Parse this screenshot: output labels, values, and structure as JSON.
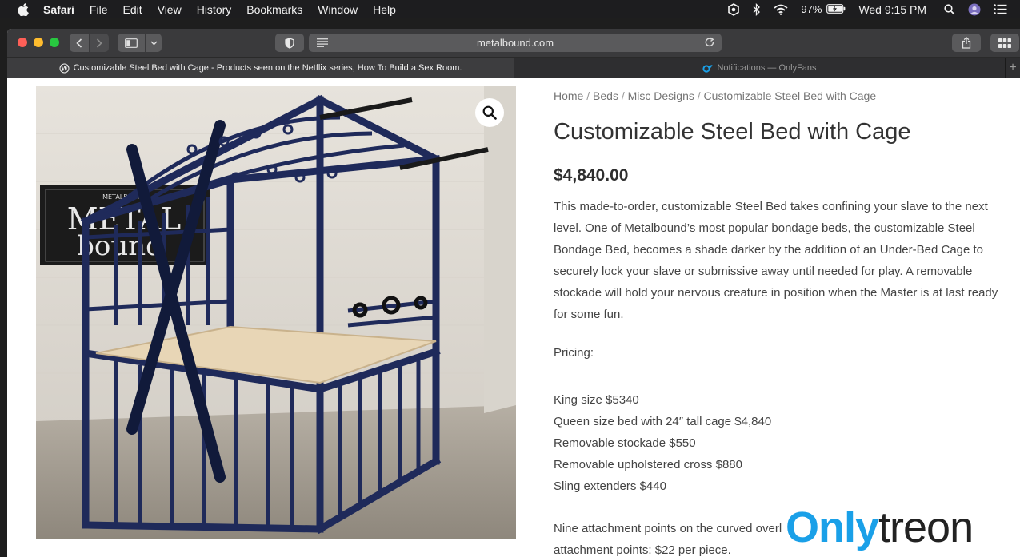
{
  "menubar": {
    "app_name": "Safari",
    "items": [
      "File",
      "Edit",
      "View",
      "History",
      "Bookmarks",
      "Window",
      "Help"
    ],
    "battery_percent": "97%",
    "clock": "Wed 9:15 PM"
  },
  "browser": {
    "url": "metalbound.com",
    "tabs": [
      {
        "title": "Customizable Steel Bed with Cage - Products seen on the Netflix series, How To Build a Sex Room.",
        "active": true
      },
      {
        "title": "Notifications — OnlyFans",
        "active": false
      }
    ],
    "new_tab_label": "+"
  },
  "product": {
    "breadcrumb": [
      "Home",
      "Beds",
      "Misc Designs",
      "Customizable Steel Bed with Cage"
    ],
    "breadcrumb_separator": "/",
    "title": "Customizable Steel Bed with Cage",
    "price": "$4,840.00",
    "description": "This made-to-order, customizable Steel Bed takes confining your slave to the next level. One of Metalbound’s most popular bondage beds, the customizable Steel Bondage Bed, becomes a shade darker by the addition of an Under-Bed Cage to securely lock your slave or submissive away until needed for play. A removable stockade will hold your nervous creature in position when the Master is at last ready for some fun.",
    "pricing_label": "Pricing:",
    "price_list": [
      "King size $5340",
      "Queen size bed with 24″ tall cage $4,840",
      "Removable stockade $550",
      "Removable upholstered cross $880",
      "Sling extenders $440"
    ],
    "attachment_text": "Nine attachment points on the curved overl",
    "attachment_text_2": "attachment points: $22 per piece.",
    "image_logo_text": [
      "METALBOUND",
      "METAL",
      "bound"
    ]
  },
  "watermark": {
    "part1": "Only",
    "part2": "treon"
  },
  "colors": {
    "accent": "#1aa0e8",
    "frame": "#1f2a5a",
    "wood": "#e8d6b6"
  }
}
